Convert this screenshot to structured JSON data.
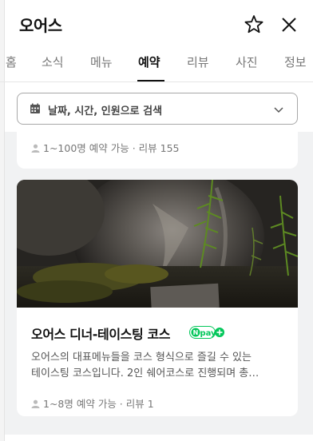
{
  "header": {
    "title": "오어스"
  },
  "tabs": [
    {
      "label": "홈",
      "active": false
    },
    {
      "label": "소식",
      "active": false
    },
    {
      "label": "메뉴",
      "active": false
    },
    {
      "label": "예약",
      "active": true
    },
    {
      "label": "리뷰",
      "active": false
    },
    {
      "label": "사진",
      "active": false
    },
    {
      "label": "정보",
      "active": false
    }
  ],
  "search": {
    "label": "날짜, 시간, 인원으로 검색",
    "icon": "calendar-icon"
  },
  "previous_card": {
    "capacity": "1~100명 예약 가능",
    "reviews": "리뷰 155"
  },
  "card": {
    "title": "오어스 디너-테이스팅 코스",
    "badge": "pay",
    "description_line1": "오어스의 대표메뉴들을 코스 형식으로 즐길 수 있는",
    "description_line2": "테이스팅 코스입니다. 2인 쉐어코스로 진행되며 총…",
    "capacity": "1~8명 예약 가능",
    "reviews": "리뷰 1"
  },
  "colors": {
    "npay_green": "#03c75a",
    "active_tab": "#111111",
    "inactive_tab": "#777777"
  }
}
